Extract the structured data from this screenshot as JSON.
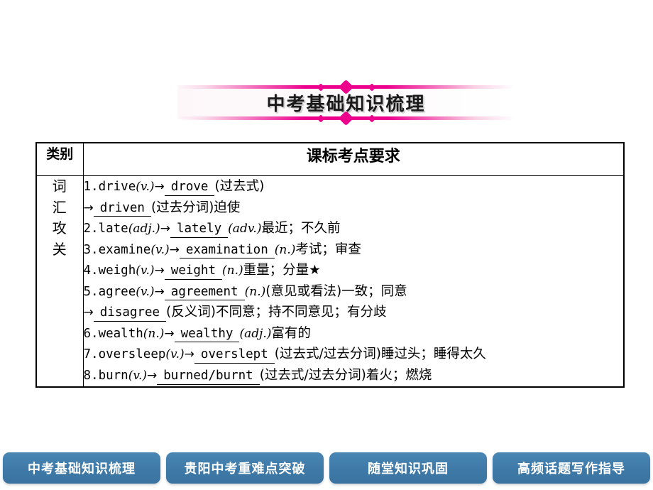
{
  "banner": {
    "title": "中考基础知识梳理",
    "accent_color": "#ec008c"
  },
  "table": {
    "headers": {
      "category": "类别",
      "requirement": "课标考点要求"
    },
    "category_label": "词汇攻关",
    "category_chars": [
      "词",
      "汇",
      "攻",
      "关"
    ],
    "entries": [
      {
        "num": "1.",
        "word": "drive",
        "pos1": "(v.)",
        "answer": "drove",
        "note": "(过去式)",
        "line2_arrow": "→",
        "line2_answer": "driven",
        "line2_note": "(过去分词)迫使"
      },
      {
        "num": "2.",
        "word": "late",
        "pos1": "(adj.)",
        "answer": "lately",
        "pos2": "(adv.)",
        "note": "最近；不久前"
      },
      {
        "num": "3.",
        "word": "examine",
        "pos1": "(v.)",
        "answer": "examination",
        "pos2": "(n.)",
        "note": "考试；审查"
      },
      {
        "num": "4.",
        "word": "weigh",
        "pos1": "(v.)",
        "answer": "weight",
        "pos2": "(n.)",
        "note": "重量；分量★"
      },
      {
        "num": "5.",
        "word": "agree",
        "pos1": "(v.)",
        "answer": "agreement",
        "pos2": "(n.)",
        "note": "(意见或看法)一致；同意",
        "line2_arrow": "→",
        "line2_answer": "disagree",
        "line2_note": "(反义词)不同意；持不同意见；有分歧"
      },
      {
        "num": "6.",
        "word": "wealth",
        "pos1": "(n.)",
        "answer": "wealthy",
        "pos2": "(adj.)",
        "note": "富有的"
      },
      {
        "num": "7.",
        "word": "oversleep",
        "pos1": "(v.)",
        "answer": "overslept",
        "note": "(过去式/过去分词)睡过头；睡得太久"
      },
      {
        "num": "8.",
        "word": "burn",
        "pos1": "(v.)",
        "answer": "burned/burnt",
        "note": "(过去式/过去分词)着火；燃烧"
      }
    ]
  },
  "bottom_nav": {
    "tabs": [
      {
        "label": "中考基础知识梳理"
      },
      {
        "label": "贵阳中考重难点突破"
      },
      {
        "label": "随堂知识巩固"
      },
      {
        "label": "高频话题写作指导"
      }
    ],
    "color": "#3f7aa8"
  }
}
